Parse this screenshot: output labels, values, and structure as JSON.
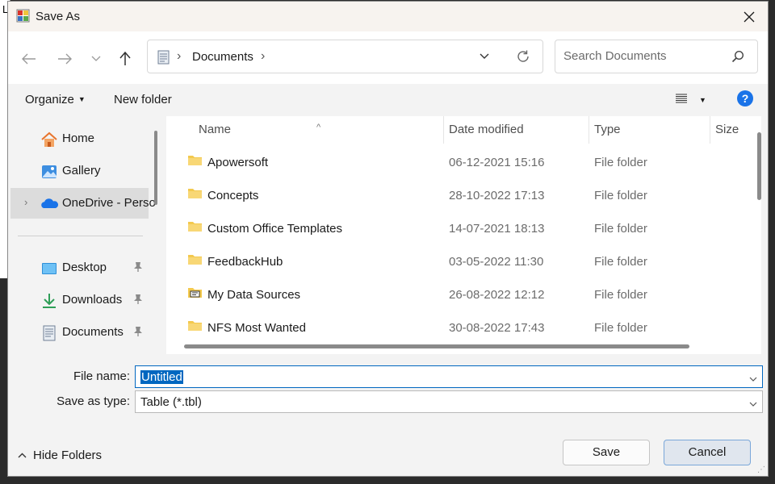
{
  "background_window": {
    "visible_letter": "L"
  },
  "dialog": {
    "title": "Save As"
  },
  "nav": {
    "address_segments": [
      "Documents"
    ],
    "search_placeholder": "Search Documents"
  },
  "command_bar": {
    "organize": "Organize",
    "new_folder": "New folder"
  },
  "sidebar": {
    "items": [
      {
        "label": "Home",
        "icon": "home-icon"
      },
      {
        "label": "Gallery",
        "icon": "gallery-icon"
      },
      {
        "label": "OneDrive - Perso",
        "icon": "onedrive-icon",
        "selected": true
      },
      {
        "label": "Desktop",
        "icon": "desktop-icon",
        "pinned": true
      },
      {
        "label": "Downloads",
        "icon": "downloads-icon",
        "pinned": true
      },
      {
        "label": "Documents",
        "icon": "documents-icon",
        "pinned": true
      }
    ]
  },
  "file_list": {
    "columns": [
      "Name",
      "Date modified",
      "Type",
      "Size"
    ],
    "rows": [
      {
        "name": "Apowersoft",
        "date": "06-12-2021 15:16",
        "type": "File folder",
        "icon": "folder-icon"
      },
      {
        "name": "Concepts",
        "date": "28-10-2022 17:13",
        "type": "File folder",
        "icon": "folder-icon"
      },
      {
        "name": "Custom Office Templates",
        "date": "14-07-2021 18:13",
        "type": "File folder",
        "icon": "folder-icon"
      },
      {
        "name": "FeedbackHub",
        "date": "03-05-2022 11:30",
        "type": "File folder",
        "icon": "folder-icon"
      },
      {
        "name": "My Data Sources",
        "date": "26-08-2022 12:12",
        "type": "File folder",
        "icon": "data-sources-folder-icon"
      },
      {
        "name": "NFS Most Wanted",
        "date": "30-08-2022 17:43",
        "type": "File folder",
        "icon": "folder-icon"
      }
    ]
  },
  "form": {
    "file_name_label": "File name:",
    "file_name_value": "Untitled",
    "save_type_label": "Save as type:",
    "save_type_value": "Table (*.tbl)"
  },
  "footer": {
    "hide_folders": "Hide Folders",
    "save": "Save",
    "cancel": "Cancel"
  },
  "colors": {
    "accent": "#0067c0",
    "folder": "#f3c94e",
    "help": "#1a73e8"
  }
}
